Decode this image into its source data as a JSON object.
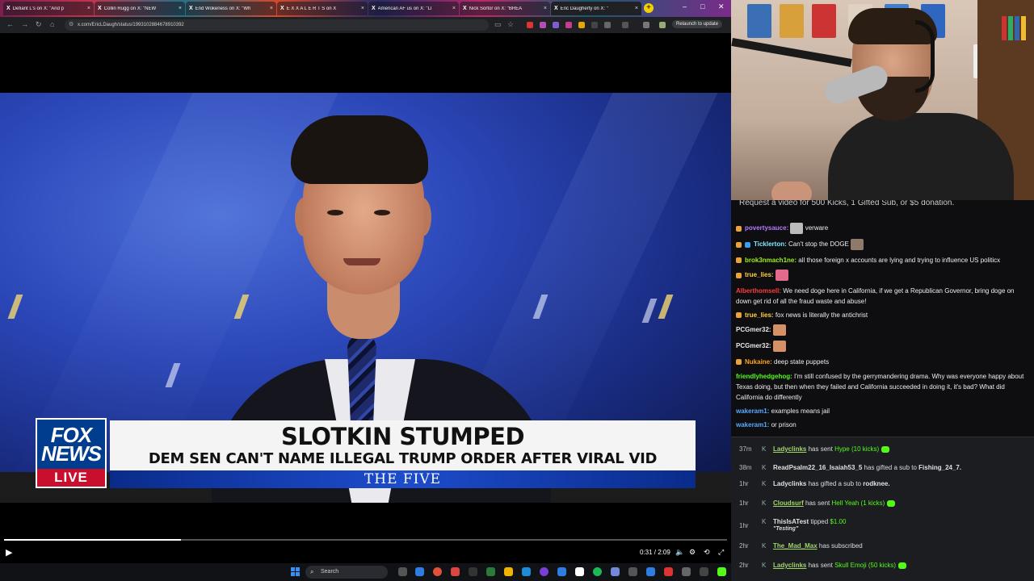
{
  "browser": {
    "tabs": [
      {
        "title": "Defiant L's on X: \"And p"
      },
      {
        "title": "Collin Rugg on X: \"NEW"
      },
      {
        "title": "End Wokeness on X: \"Wh"
      },
      {
        "title": "E X X A L E R T S on X"
      },
      {
        "title": "American AF us on X: \"LI"
      },
      {
        "title": "Nick Sortor on X: \"BREA"
      },
      {
        "title": "Eric Daugherty on X: \""
      }
    ],
    "url": "x.com/EricLDaugh/status/1993102884678910392",
    "relaunch_label": "Relaunch to update"
  },
  "video": {
    "headline": "SLOTKIN STUMPED",
    "subheadline": "DEM SEN CAN'T NAME ILLEGAL TRUMP ORDER AFTER VIRAL VID",
    "show_name": "THE FIVE",
    "logo_line1": "FOX",
    "logo_line2": "NEWS",
    "logo_live": "LIVE",
    "time": "0:31 / 2:09",
    "progress": 0.245
  },
  "taskbar": {
    "search_label": "Search"
  },
  "chat": {
    "banner": "Request a video for 500 Kicks, 1 Gifted Sub, or $5 donation.",
    "messages": [
      {
        "user": "povertysauce:",
        "text": "verware",
        "color": "#b57bff"
      },
      {
        "user": "Ticklerton:",
        "text": "Can't stop the DOGE",
        "color": "#7ee9ff"
      },
      {
        "user": "brok3nmach1ne:",
        "text": "all those foreign x accounts are lying and trying to influence US politicx",
        "color": "#9ef01a"
      },
      {
        "user": "true_lies:",
        "text": "",
        "color": "#ffd23f"
      },
      {
        "user": "Alberthomsell:",
        "text": "We need doge here in California, if we get a Republican Governor, bring doge on down get rid of all the fraud waste and abuse!",
        "color": "#ff3b3b"
      },
      {
        "user": "true_lies:",
        "text": "fox news is literally the antichrist",
        "color": "#ffd23f"
      },
      {
        "user": "PCGmer32:",
        "text": "",
        "color": "#e8e8e8"
      },
      {
        "user": "PCGmer32:",
        "text": "",
        "color": "#e8e8e8"
      },
      {
        "user": "Nukaine:",
        "text": "deep state puppets",
        "color": "#ffa41b"
      },
      {
        "user": "friendlyhedgehog:",
        "text": "I'm still confused by the gerrymandering drama. Why was everyone happy about Texas doing, but then when they failed and California succeeded in doing it, it's bad? What did California do differently",
        "color": "#53fc18"
      },
      {
        "user": "wakeram1:",
        "text": "examples means jail",
        "color": "#5aa8ff"
      },
      {
        "user": "wakeram1:",
        "text": "or prison",
        "color": "#5aa8ff"
      }
    ]
  },
  "events": [
    {
      "when": "37m",
      "user": "Ladyclinks",
      "action": "has sent",
      "gift": "Hype (10 kicks)"
    },
    {
      "when": "38m",
      "user": "ReadPsalm22_16_Isaiah53_5",
      "action": "has gifted a sub to",
      "target": "Fishing_24_7."
    },
    {
      "when": "1hr",
      "user": "Ladyclinks",
      "action": "has gifted a sub to",
      "target": "rodknee."
    },
    {
      "when": "1hr",
      "user": "Cloudsurf",
      "action": "has sent",
      "gift": "Hell Yeah (1 kicks)"
    },
    {
      "when": "1hr",
      "user": "ThisIsATest",
      "action": "tipped",
      "gift": "$1.00",
      "note": "\"Testing\""
    },
    {
      "when": "2hr",
      "user": "The_Mad_Max",
      "action": "has subscribed"
    },
    {
      "when": "2hr",
      "user": "Ladyclinks",
      "action": "has sent",
      "gift": "Skull Emoji (50 kicks)"
    }
  ]
}
